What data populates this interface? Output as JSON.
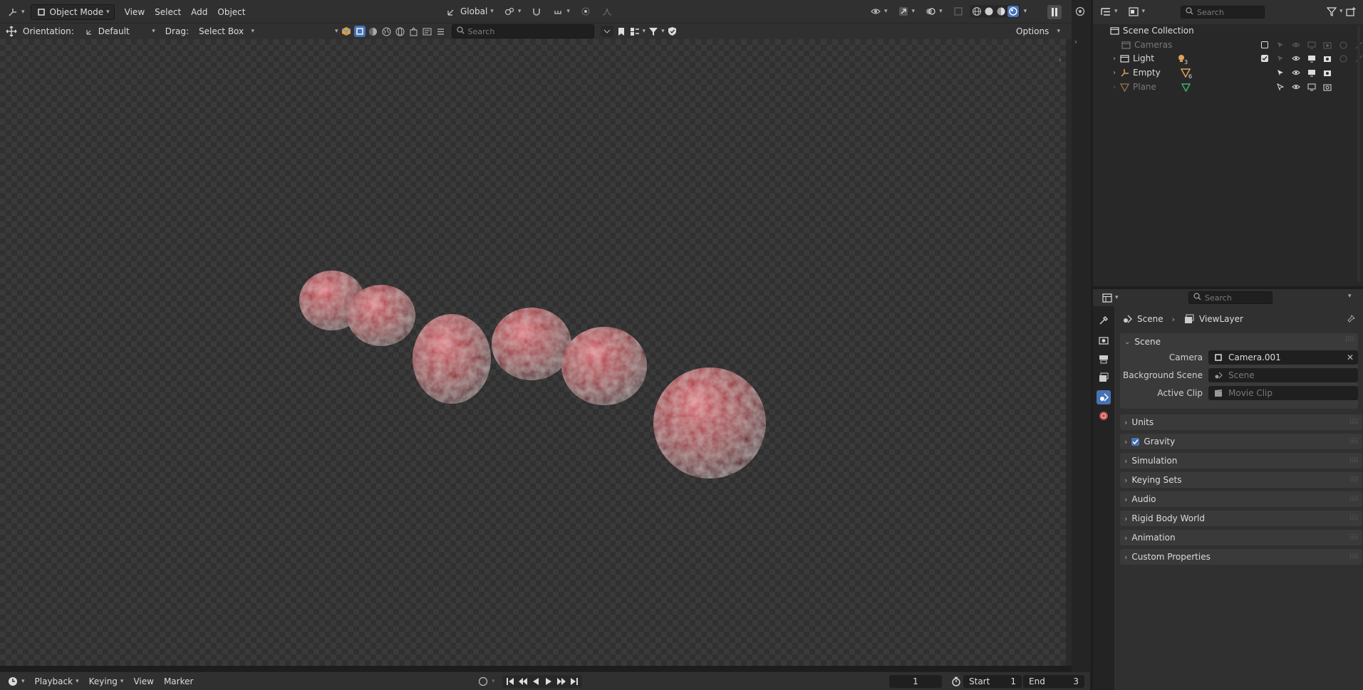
{
  "viewport_header": {
    "mode_label": "Object Mode",
    "menu": [
      "View",
      "Select",
      "Add",
      "Object"
    ],
    "transform_orientation": "Global"
  },
  "tool_header": {
    "orientation_label": "Orientation:",
    "orientation_value": "Default",
    "drag_label": "Drag:",
    "drag_value": "Select Box",
    "search_placeholder": "Search",
    "options_label": "Options"
  },
  "timeline": {
    "menu": [
      "Playback",
      "Keying",
      "View",
      "Marker"
    ],
    "current_frame": "1",
    "start_label": "Start",
    "start_value": "1",
    "end_label": "End",
    "end_value": "3"
  },
  "outliner": {
    "search_placeholder": "Search",
    "root": "Scene Collection",
    "items": [
      {
        "name": "Cameras",
        "dim": true,
        "badge": ""
      },
      {
        "name": "Light",
        "dim": false,
        "badge": "3"
      },
      {
        "name": "Empty",
        "dim": false,
        "badge": "6"
      },
      {
        "name": "Plane",
        "dim": true,
        "badge": ""
      }
    ]
  },
  "properties": {
    "search_placeholder": "Search",
    "breadcrumb": [
      "Scene",
      "ViewLayer"
    ],
    "scene_panel": {
      "title": "Scene",
      "camera_label": "Camera",
      "camera_value": "Camera.001",
      "background_label": "Background Scene",
      "background_placeholder": "Scene",
      "clip_label": "Active Clip",
      "clip_placeholder": "Movie Clip"
    },
    "panels": [
      "Units",
      "Gravity",
      "Simulation",
      "Keying Sets",
      "Audio",
      "Rigid Body World",
      "Animation",
      "Custom Properties"
    ]
  },
  "colors": {
    "accent": "#4772b3",
    "header": "#303030",
    "panel": "#3a3a3a",
    "sphere": "#9c1e2a"
  }
}
